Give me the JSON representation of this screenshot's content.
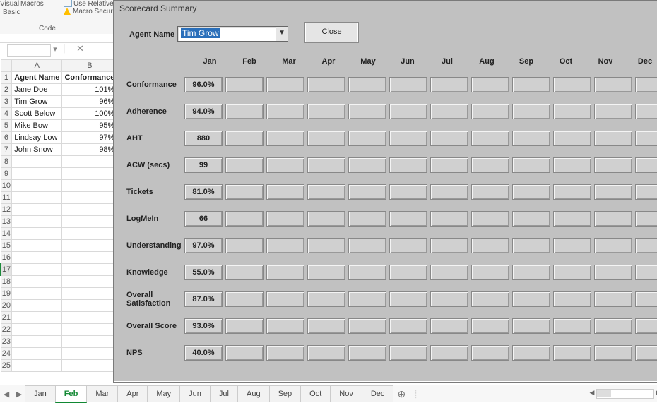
{
  "ribbon": {
    "visual_label": "Visual",
    "macros_label": "Macros",
    "basic_label": "Basic",
    "use_relative_label": "Use Relative Re",
    "macro_security_label": "Macro Security",
    "group_label": "Code"
  },
  "sheet": {
    "col_letters": [
      "A",
      "B"
    ],
    "headers": [
      "Agent Name",
      "Conformance"
    ],
    "rows": [
      {
        "name": "Jane Doe",
        "conf": "101%"
      },
      {
        "name": "Tim Grow",
        "conf": "96%"
      },
      {
        "name": "Scott Below",
        "conf": "100%"
      },
      {
        "name": "Mike Bow",
        "conf": "95%"
      },
      {
        "name": "Lindsay Low",
        "conf": "97%"
      },
      {
        "name": "John Snow",
        "conf": "98%"
      }
    ]
  },
  "userform": {
    "title": "Scorecard Summary",
    "agent_name_label": "Agent Name",
    "agent_name_value": "Tim Grow",
    "close_label": "Close",
    "months": [
      "Jan",
      "Feb",
      "Mar",
      "Apr",
      "May",
      "Jun",
      "Jul",
      "Aug",
      "Sep",
      "Oct",
      "Nov",
      "Dec"
    ],
    "metrics": [
      {
        "label": "Conformance",
        "values": [
          "96.0%",
          "",
          "",
          "",
          "",
          "",
          "",
          "",
          "",
          "",
          "",
          ""
        ]
      },
      {
        "label": "Adherence",
        "values": [
          "94.0%",
          "",
          "",
          "",
          "",
          "",
          "",
          "",
          "",
          "",
          "",
          ""
        ]
      },
      {
        "label": "AHT",
        "values": [
          "880",
          "",
          "",
          "",
          "",
          "",
          "",
          "",
          "",
          "",
          "",
          ""
        ]
      },
      {
        "label": "ACW (secs)",
        "values": [
          "99",
          "",
          "",
          "",
          "",
          "",
          "",
          "",
          "",
          "",
          "",
          ""
        ]
      },
      {
        "label": "Tickets",
        "values": [
          "81.0%",
          "",
          "",
          "",
          "",
          "",
          "",
          "",
          "",
          "",
          "",
          ""
        ]
      },
      {
        "label": "LogMeIn",
        "values": [
          "66",
          "",
          "",
          "",
          "",
          "",
          "",
          "",
          "",
          "",
          "",
          ""
        ]
      },
      {
        "label": "Understanding",
        "values": [
          "97.0%",
          "",
          "",
          "",
          "",
          "",
          "",
          "",
          "",
          "",
          "",
          ""
        ]
      },
      {
        "label": "Knowledge",
        "values": [
          "55.0%",
          "",
          "",
          "",
          "",
          "",
          "",
          "",
          "",
          "",
          "",
          ""
        ]
      },
      {
        "label": "Overall Satisfaction",
        "values": [
          "87.0%",
          "",
          "",
          "",
          "",
          "",
          "",
          "",
          "",
          "",
          "",
          ""
        ]
      },
      {
        "label": "Overall Score",
        "values": [
          "93.0%",
          "",
          "",
          "",
          "",
          "",
          "",
          "",
          "",
          "",
          "",
          ""
        ]
      },
      {
        "label": "NPS",
        "values": [
          "40.0%",
          "",
          "",
          "",
          "",
          "",
          "",
          "",
          "",
          "",
          "",
          ""
        ]
      }
    ]
  },
  "tabs": {
    "list": [
      "Jan",
      "Feb",
      "Mar",
      "Apr",
      "May",
      "Jun",
      "Jul",
      "Aug",
      "Sep",
      "Oct",
      "Nov",
      "Dec"
    ],
    "active": "Feb"
  }
}
